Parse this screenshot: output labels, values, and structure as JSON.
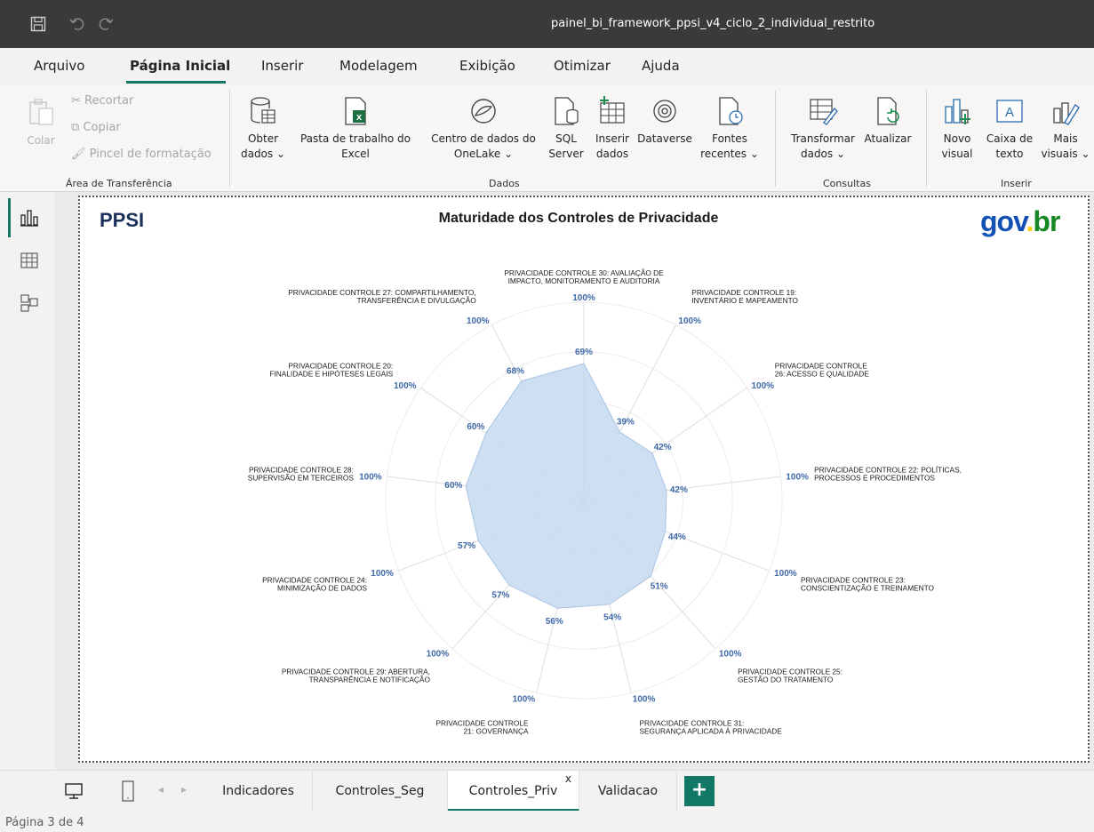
{
  "titlebar": {
    "title": "painel_bi_framework_ppsi_v4_ciclo_2_individual_restrito",
    "save_icon": "save-icon",
    "undo_icon": "undo-icon",
    "redo_icon": "redo-icon"
  },
  "menu": {
    "items": [
      "Arquivo",
      "Página Inicial",
      "Inserir",
      "Modelagem",
      "Exibição",
      "Otimizar",
      "Ajuda"
    ],
    "active": "Página Inicial"
  },
  "ribbon": {
    "clipboard": {
      "paste": "Colar",
      "cut": "Recortar",
      "copy": "Copiar",
      "format_painter": "Pincel de formatação",
      "group_label": "Área de Transferência"
    },
    "data": {
      "get_data_line1": "Obter",
      "get_data_line2": "dados ⌄",
      "excel_line1": "Pasta de trabalho do",
      "excel_line2": "Excel",
      "onelake_line1": "Centro de dados do",
      "onelake_line2": "OneLake ⌄",
      "sql_line1": "SQL",
      "sql_line2": "Server",
      "enter_data_line1": "Inserir",
      "enter_data_line2": "dados",
      "dataverse": "Dataverse",
      "recent_line1": "Fontes",
      "recent_line2": "recentes ⌄",
      "group_label": "Dados"
    },
    "queries": {
      "transform_line1": "Transformar",
      "transform_line2": "dados ⌄",
      "refresh": "Atualizar",
      "group_label": "Consultas"
    },
    "insert": {
      "new_visual_line1": "Novo",
      "new_visual_line2": "visual",
      "textbox_line1": "Caixa de",
      "textbox_line2": "texto",
      "more_visuals_line1": "Mais",
      "more_visuals_line2": "visuais ⌄",
      "group_label": "Inserir"
    }
  },
  "report": {
    "logo_text": "PPSI",
    "title": "Maturidade dos Controles de Privacidade",
    "brand": {
      "gov": "gov",
      "dot": ".",
      "br": "br"
    },
    "colors": {
      "fill": "#c6d9ee",
      "values": "#3f69a8",
      "gov_blue": "#1351b4",
      "gov_yellow": "#ffcd07",
      "gov_green": "#168821"
    }
  },
  "chart_data": {
    "type": "radar",
    "title": "Maturidade dos Controles de Privacidade",
    "max": 100,
    "categories": [
      {
        "label": [
          "PRIVACIDADE CONTROLE 30: AVALIAÇÃO DE",
          "IMPACTO, MONITORAMENTO E AUDITORIA"
        ],
        "value": 69,
        "target": 100,
        "value_label": "69%",
        "target_label": "100%"
      },
      {
        "label": [
          "PRIVACIDADE CONTROLE 19:",
          "INVENTÁRIO E MAPEAMENTO"
        ],
        "value": 39,
        "target": 100,
        "value_label": "39%",
        "target_label": "100%"
      },
      {
        "label": [
          "PRIVACIDADE CONTROLE",
          "26: ACESSO E QUALIDADE"
        ],
        "value": 42,
        "target": 100,
        "value_label": "42%",
        "target_label": "100%"
      },
      {
        "label": [
          "PRIVACIDADE CONTROLE 22: POLÍTICAS,",
          "PROCESSOS E PROCEDIMENTOS"
        ],
        "value": 42,
        "target": 100,
        "value_label": "42%",
        "target_label": "100%"
      },
      {
        "label": [
          "PRIVACIDADE CONTROLE 23:",
          "CONSCIENTIZAÇÃO E TREINAMENTO"
        ],
        "value": 44,
        "target": 100,
        "value_label": "44%",
        "target_label": "100%"
      },
      {
        "label": [
          "PRIVACIDADE CONTROLE 25:",
          "GESTÃO DO TRATAMENTO"
        ],
        "value": 51,
        "target": 100,
        "value_label": "51%",
        "target_label": "100%"
      },
      {
        "label": [
          "PRIVACIDADE CONTROLE 31:",
          "SEGURANÇA APLICADA À PRIVACIDADE"
        ],
        "value": 54,
        "target": 100,
        "value_label": "54%",
        "target_label": "100%"
      },
      {
        "label": [
          "PRIVACIDADE CONTROLE",
          "21: GOVERNANÇA"
        ],
        "value": 56,
        "target": 100,
        "value_label": "56%",
        "target_label": "100%"
      },
      {
        "label": [
          "PRIVACIDADE CONTROLE 29: ABERTURA,",
          "TRANSPARÊNCIA E NOTIFICAÇÃO"
        ],
        "value": 57,
        "target": 100,
        "value_label": "57%",
        "target_label": "100%"
      },
      {
        "label": [
          "PRIVACIDADE CONTROLE 24:",
          "MINIMIZAÇÃO DE DADOS"
        ],
        "value": 57,
        "target": 100,
        "value_label": "57%",
        "target_label": "100%"
      },
      {
        "label": [
          "PRIVACIDADE CONTROLE 28:",
          "SUPERVISÃO EM TERCEIROS"
        ],
        "value": 60,
        "target": 100,
        "value_label": "60%",
        "target_label": "100%"
      },
      {
        "label": [
          "PRIVACIDADE CONTROLE 20:",
          "FINALIDADE E HIPÓTESES LEGAIS"
        ],
        "value": 60,
        "target": 100,
        "value_label": "60%",
        "target_label": "100%"
      },
      {
        "label": [
          "PRIVACIDADE CONTROLE 27: COMPARTILHAMENTO,",
          "TRANSFERÊNCIA E DIVULGAÇÃO"
        ],
        "value": 68,
        "target": 100,
        "value_label": "68%",
        "target_label": "100%"
      }
    ]
  },
  "pages": {
    "tabs": [
      "Indicadores",
      "Controles_Seg",
      "Controles_Priv",
      "Validacao"
    ],
    "active": "Controles_Priv",
    "close_glyph": "x",
    "add_glyph": "+"
  },
  "status": {
    "page_text": "Página 3 de 4"
  }
}
